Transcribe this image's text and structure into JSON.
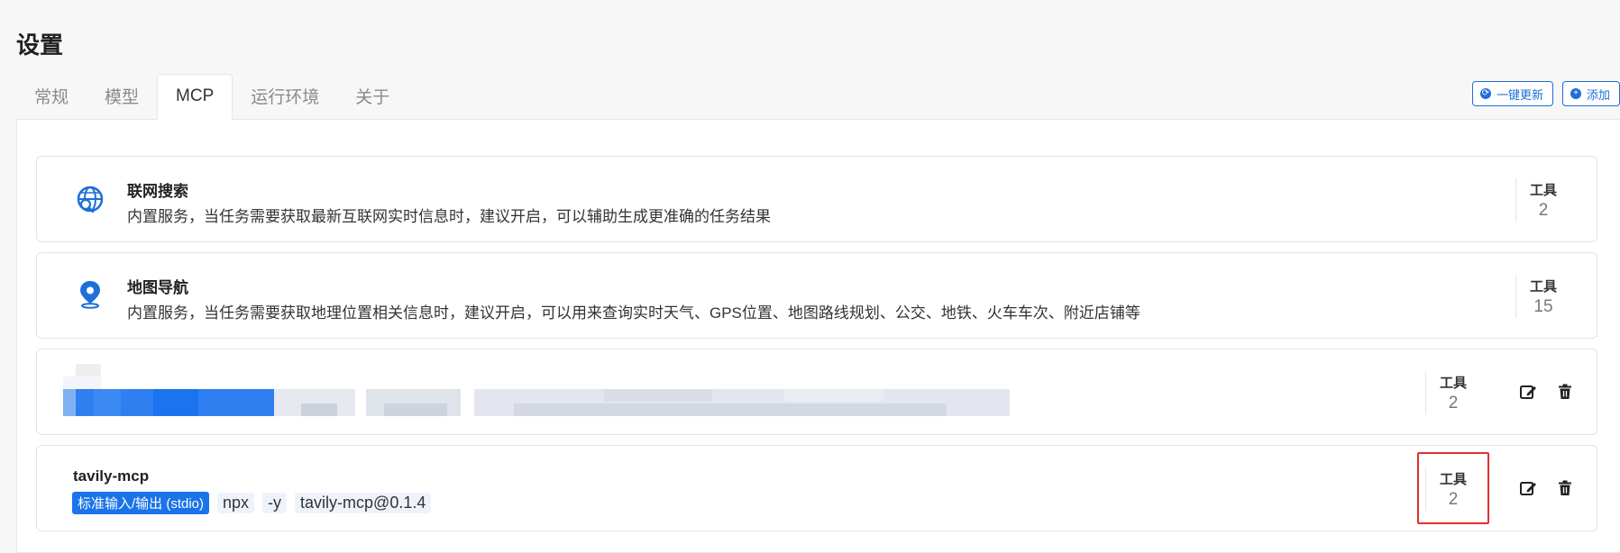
{
  "page": {
    "title": "设置"
  },
  "tabs": [
    {
      "label": "常规",
      "active": false
    },
    {
      "label": "模型",
      "active": false
    },
    {
      "label": "MCP",
      "active": true
    },
    {
      "label": "运行环境",
      "active": false
    },
    {
      "label": "关于",
      "active": false
    }
  ],
  "toolbar": {
    "update_label": "一键更新",
    "add_label": "添加"
  },
  "servers": [
    {
      "name": "联网搜索",
      "description": "内置服务，当任务需要获取最新互联网实时信息时，建议开启，可以辅助生成更准确的任务结果",
      "tools_label": "工具",
      "tools_count": "2",
      "icon": "globe-search-icon"
    },
    {
      "name": "地图导航",
      "description": "内置服务，当任务需要获取地理位置相关信息时，建议开启，可以用来查询实时天气、GPS位置、地图路线规划、公交、地铁、火车车次、附近店铺等",
      "tools_label": "工具",
      "tools_count": "15",
      "icon": "map-pin-icon"
    },
    {
      "name": "",
      "description": "",
      "tools_label": "工具",
      "tools_count": "2",
      "redacted": true
    },
    {
      "name": "tavily-mcp",
      "tags": [
        "标准输入/输出 (stdio)",
        "npx",
        "-y",
        "tavily-mcp@0.1.4"
      ],
      "tools_label": "工具",
      "tools_count": "2"
    }
  ],
  "colors": {
    "accent": "#1d6fd8",
    "highlight": "#e0312b"
  }
}
